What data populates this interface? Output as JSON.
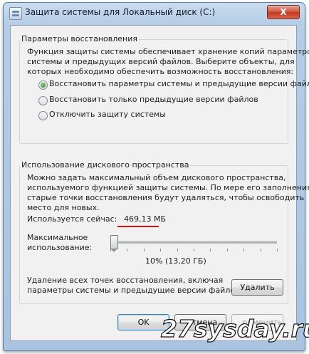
{
  "window": {
    "title": "Защита системы для Локальный диск (С:)",
    "close_glyph": "X"
  },
  "restore_group": {
    "title": "Параметры восстановления",
    "description": [
      "Функция защиты системы обеспечивает хранение копий параметров",
      "системы и предыдущих версий файлов. Выберите объекты, для",
      "которых необходимо обеспечить возможность восстановления:"
    ],
    "options": [
      {
        "label": "Восстановить параметры системы и предыдущие версии файлов",
        "selected": true
      },
      {
        "label": "Восстановить только предыдущие версии файлов",
        "selected": false
      },
      {
        "label": "Отключить защиту системы",
        "selected": false
      }
    ]
  },
  "disk_group": {
    "title": "Использование дискового пространства",
    "description": [
      "Можно задать максимальный объем дискового пространства,",
      "используемого функцией защиты системы. По мере его заполнения",
      "старые точки восстановления будут удаляться, чтобы освободить",
      "место для новых."
    ],
    "used_label": "Используется сейчас:",
    "used_value": "469,13 МБ",
    "max_label_line1": "Максимальное",
    "max_label_line2": "использование:",
    "slider_percent": 10,
    "slider_readout": "10% (13,20 ГБ)",
    "delete_text_line1": "Удаление всех точек восстановления, включая",
    "delete_text_line2": "параметры системы и предыдущие версии файлов.",
    "delete_button": "Удалить"
  },
  "footer": {
    "ok": "OK",
    "cancel": "тмена",
    "apply": "рименить"
  },
  "watermark": "27sysday.ru",
  "colors": {
    "highlight_underline": "#cf1515",
    "radio_selected": "#2f7b1c"
  }
}
